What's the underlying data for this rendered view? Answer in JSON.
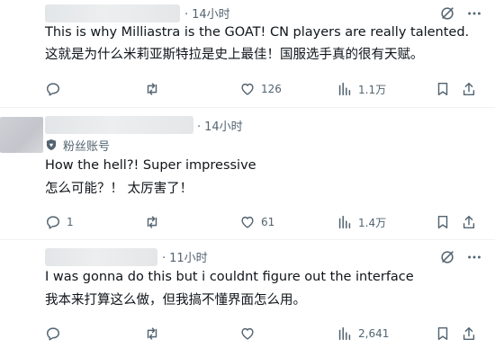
{
  "tweets": [
    {
      "time": "14小时",
      "lines": [
        "This is why Milliastra is the GOAT! CN players are really talented.",
        "这就是为什么米莉亚斯特拉是史上最佳！国服选手真的很有天赋。"
      ],
      "likes": "126",
      "views": "1.1万"
    },
    {
      "time": "14小时",
      "badge": "粉丝账号",
      "lines": [
        "How the hell?! Super impressive",
        "怎么可能？！ 太厉害了！"
      ],
      "replies": "1",
      "likes": "61",
      "views": "1.4万"
    },
    {
      "time": "11小时",
      "lines": [
        "I was gonna do this but i couldnt figure out the interface",
        "我本来打算这么做，但我搞不懂界面怎么用。"
      ],
      "views": "2,641"
    }
  ],
  "icons": {
    "grok": "grok-icon",
    "more": "more-icon",
    "reply": "reply-icon",
    "repost": "repost-icon",
    "like": "heart-icon",
    "views": "views-icon",
    "bookmark": "bookmark-icon",
    "share": "share-icon",
    "badge": "fan-badge-icon"
  },
  "colors": {
    "text": "#0f1419",
    "secondary": "#536471",
    "divider": "#eff3f4"
  }
}
